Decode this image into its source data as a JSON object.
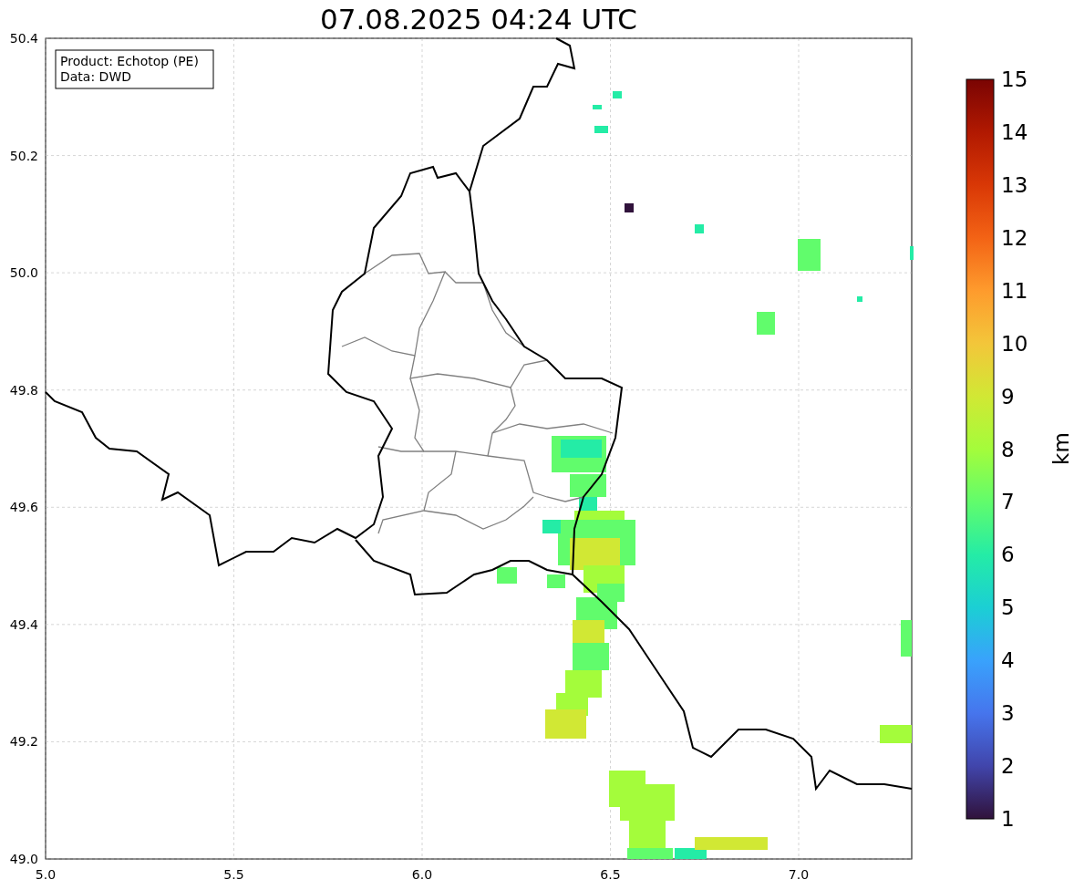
{
  "title": "07.08.2025 04:24 UTC",
  "legend": [
    "Product: Echotop (PE)",
    "Data: DWD"
  ],
  "x_ticks": [
    "5.0",
    "5.5",
    "6.0",
    "6.5",
    "7.0"
  ],
  "y_ticks": [
    "50.4",
    "50.2",
    "50.0",
    "49.8",
    "49.6",
    "49.4",
    "49.2",
    "49.0"
  ],
  "colorbar": {
    "label": "km",
    "ticks": [
      "15",
      "14",
      "13",
      "12",
      "11",
      "10",
      "9",
      "8",
      "7",
      "6",
      "5",
      "4",
      "3",
      "2",
      "1"
    ]
  }
}
